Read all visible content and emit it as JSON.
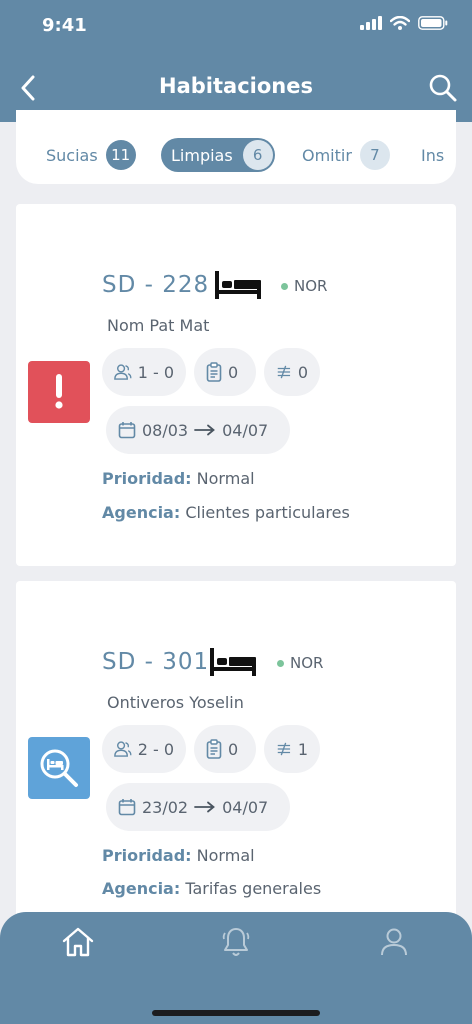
{
  "status_bar": {
    "time": "9:41"
  },
  "header": {
    "title": "Habitaciones"
  },
  "tabs": [
    {
      "label": "Sucias",
      "count": "11"
    },
    {
      "label": "Limpias",
      "count": "6"
    },
    {
      "label": "Omitir",
      "count": "7"
    },
    {
      "label": "Ins"
    }
  ],
  "rooms": [
    {
      "number": "SD - 228",
      "type": "NOR",
      "guest": "Nom Pat Mat",
      "guests": "1 - 0",
      "notes": "0",
      "tasks": "0",
      "date_from": "08/03",
      "date_to": "04/07",
      "priority_label": "Prioridad:",
      "priority": "Normal",
      "agency_label": "Agencia:",
      "agency": "Clientes particulares",
      "status_icon": "alert-icon",
      "status_color": "#e1515a"
    },
    {
      "number": "SD - 301",
      "type": "NOR",
      "guest": "Ontiveros Yoselin",
      "guests": "2 - 0",
      "notes": "0",
      "tasks": "1",
      "date_from": "23/02",
      "date_to": "04/07",
      "priority_label": "Prioridad:",
      "priority": "Normal",
      "agency_label": "Agencia:",
      "agency": "Tarifas generales",
      "status_icon": "inspect-bed-icon",
      "status_color": "#5fa3d9"
    }
  ],
  "nav": [
    "home-icon",
    "bell-icon",
    "user-icon"
  ],
  "colors": {
    "primary": "#6289a6",
    "background": "#edeef2",
    "alert": "#e1515a",
    "inspect": "#5fa3d9",
    "dot": "#7cc49b"
  }
}
